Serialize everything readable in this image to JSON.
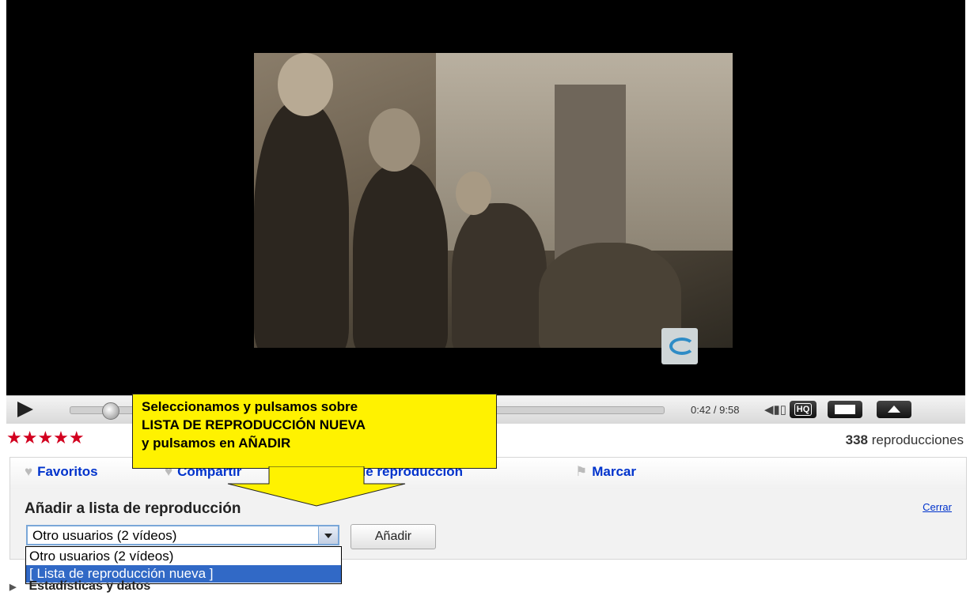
{
  "player": {
    "time": "0:42 / 9:58",
    "hq_label": "HQ"
  },
  "rating": {
    "stars": "★★★★★",
    "value": 4.5,
    "max": 5
  },
  "views": {
    "count": "338",
    "label": "reproducciones"
  },
  "tabs": [
    {
      "label": "Favoritos"
    },
    {
      "label": "Compartir"
    },
    {
      "label": "Listas de reproducción"
    },
    {
      "label": "Marcar"
    }
  ],
  "panel": {
    "title": "Añadir a lista de reproducción",
    "close": "Cerrar",
    "select_value": "Otro usuarios (2 vídeos)",
    "add_button": "Añadir",
    "options": [
      "Otro usuarios (2 vídeos)",
      "[ Lista de reproducción nueva ]"
    ]
  },
  "stats_label": "Estadísticas y datos",
  "callout": {
    "line1": "Seleccionamos y pulsamos sobre",
    "line2": "LISTA DE REPRODUCCIÓN NUEVA",
    "line3": "y pulsamos en AÑADIR"
  },
  "colors": {
    "callout": "#fff200",
    "stars": "#d2001f",
    "link": "#0033cc",
    "selected_option": "#3169c6"
  }
}
